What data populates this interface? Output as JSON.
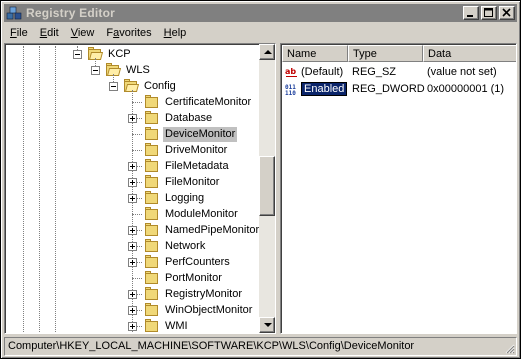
{
  "window": {
    "title": "Registry Editor"
  },
  "menu": [
    {
      "label": "File",
      "key": "F",
      "rest": "ile"
    },
    {
      "label": "Edit",
      "key": "E",
      "rest": "dit"
    },
    {
      "label": "View",
      "key": "V",
      "rest": "iew"
    },
    {
      "label": "Favorites",
      "key": "a",
      "pre": "F",
      "rest": "vorites"
    },
    {
      "label": "Help",
      "key": "H",
      "rest": "elp"
    }
  ],
  "tree": {
    "parents": [
      "KCP",
      "WLS",
      "Config"
    ],
    "children": [
      {
        "label": "CertificateMonitor",
        "expandable": false
      },
      {
        "label": "Database",
        "expandable": true
      },
      {
        "label": "DeviceMonitor",
        "expandable": false,
        "selected": true
      },
      {
        "label": "DriveMonitor",
        "expandable": false
      },
      {
        "label": "FileMetadata",
        "expandable": true
      },
      {
        "label": "FileMonitor",
        "expandable": true
      },
      {
        "label": "Logging",
        "expandable": true
      },
      {
        "label": "ModuleMonitor",
        "expandable": false
      },
      {
        "label": "NamedPipeMonitor",
        "expandable": true
      },
      {
        "label": "Network",
        "expandable": true
      },
      {
        "label": "PerfCounters",
        "expandable": true
      },
      {
        "label": "PortMonitor",
        "expandable": false
      },
      {
        "label": "RegistryMonitor",
        "expandable": true
      },
      {
        "label": "WinObjectMonitor",
        "expandable": true
      },
      {
        "label": "WMI",
        "expandable": true
      }
    ]
  },
  "list": {
    "columns": [
      "Name",
      "Type",
      "Data"
    ],
    "rows": [
      {
        "icon": "string-value-icon",
        "name": "(Default)",
        "type": "REG_SZ",
        "data": "(value not set)",
        "editing": false
      },
      {
        "icon": "dword-value-icon",
        "name": "Enabled",
        "type": "REG_DWORD",
        "data": "0x00000001 (1)",
        "editing": true
      }
    ]
  },
  "status": {
    "path": "Computer\\HKEY_LOCAL_MACHINE\\SOFTWARE\\KCP\\WLS\\Config\\DeviceMonitor"
  },
  "icons": {
    "app": "registry-editor-icon",
    "minimize": "minimize-icon",
    "maximize": "maximize-icon",
    "close": "close-icon"
  }
}
